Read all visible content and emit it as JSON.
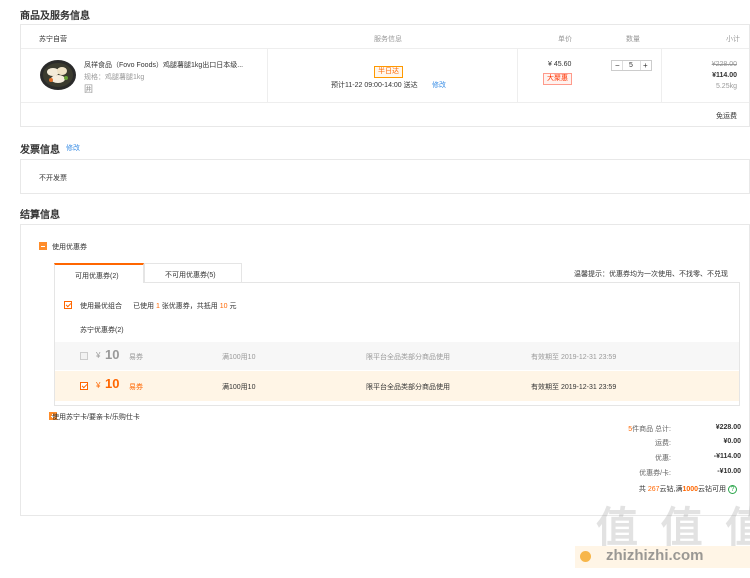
{
  "goods_section": {
    "title": "商品及服务信息",
    "headers": {
      "store": "苏宁自营",
      "service": "服务信息",
      "price": "单价",
      "qty": "数量",
      "subtotal": "小计"
    },
    "item": {
      "name": "凤祥食品（Fovo Foods）鸡腿薯腿1kg出口日本级...",
      "spec": "规格：鸡腿薯腿1kg",
      "extra_mark": "囲",
      "service_tag": "半日达",
      "delivery_text": "预计11-22 09:00-14:00 送达",
      "delivery_edit": "修改",
      "price": "¥ 45.60",
      "price_tag": "大聚惠",
      "qty": "5",
      "qty_minus": "−",
      "qty_plus": "+",
      "original_total": "¥228.00",
      "total": "¥114.00",
      "weight": "5.25kg"
    },
    "footer_note": "免运费"
  },
  "invoice_section": {
    "title": "发票信息",
    "edit": "修改",
    "value": "不开发票"
  },
  "settlement_section": {
    "title": "结算信息",
    "coupon_toggle": "使用优惠券",
    "tabs": [
      {
        "label": "可用优惠券(2)"
      },
      {
        "label": "不可用优惠券(5)"
      }
    ],
    "tip": "温馨提示：优惠券均为一次使用、不找零、不兑现",
    "best_combo": {
      "label": "使用最优组合",
      "text_pre": "已使用",
      "count": "1",
      "text_mid": "张优惠券，共抵用",
      "amount": "10",
      "text_post": "元"
    },
    "group_title": "苏宁优惠券(2)",
    "coupons": [
      {
        "currency": "¥",
        "amount": "10",
        "type": "易券",
        "rule": "满100用10",
        "scope": "限平台全品类部分商品使用",
        "expire": "有效期至 2019-12-31 23:59"
      },
      {
        "currency": "¥",
        "amount": "10",
        "type": "易券",
        "rule": "满100用10",
        "scope": "限平台全品类部分商品使用",
        "expire": "有效期至 2019-12-31 23:59"
      }
    ],
    "card_toggle": "使用苏宁卡/要亲卡/乐购仕卡"
  },
  "summary": {
    "count_prefix": "5",
    "goods_label": "件商品 总计:",
    "goods_value": "¥228.00",
    "shipping_label": "运费:",
    "shipping_value": "¥0.00",
    "discount_label": "优惠:",
    "discount_value": "-¥114.00",
    "coupon_label": "优惠券/卡:",
    "coupon_value": "-¥10.00",
    "points_pre": "共",
    "points_total": "267",
    "points_mid": "云钻,满",
    "points_min": "1000",
    "points_post": "云钻可用",
    "help": "?"
  },
  "watermark": {
    "text": "值 值 值",
    "site": "zhizhizhi.com"
  },
  "colors": {
    "accent": "#ff6600",
    "link": "#3a8ee6",
    "selected_row": "#fff5e6"
  }
}
